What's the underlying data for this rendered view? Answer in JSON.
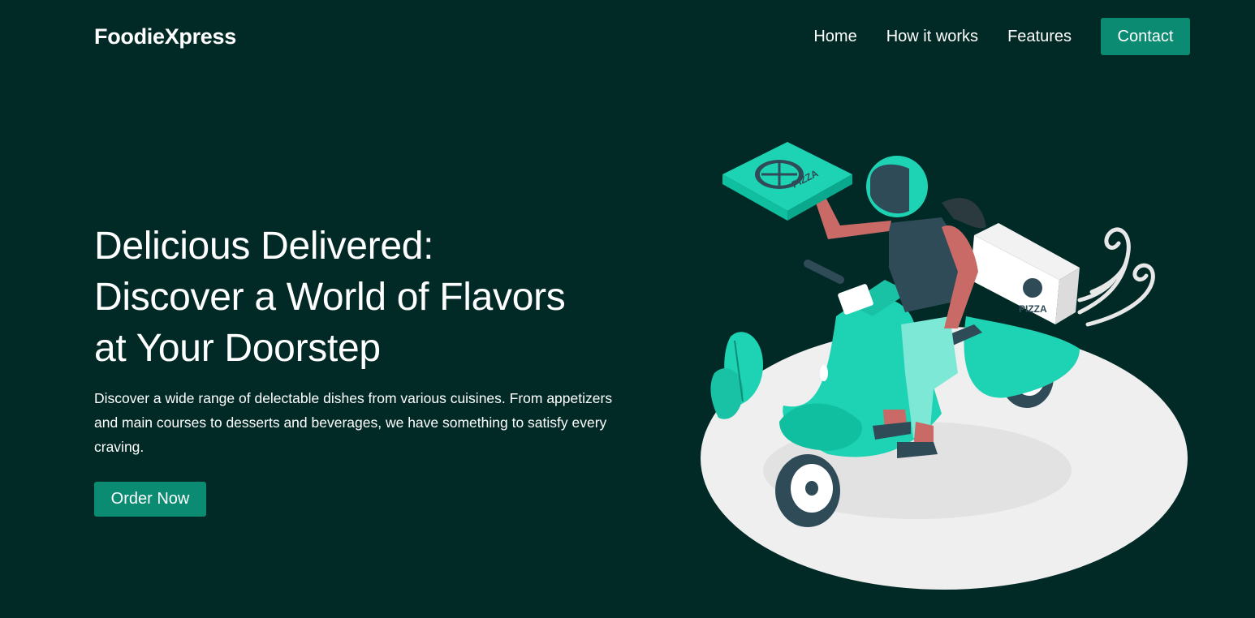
{
  "navbar": {
    "brand": "FoodieXpress",
    "links": [
      "Home",
      "How it works",
      "Features"
    ],
    "contact_label": "Contact"
  },
  "hero": {
    "title_lines": [
      "Delicious Delivered:",
      "Discover a World of Flavors",
      "at Your Doorstep"
    ],
    "description": "Discover a wide range of delectable dishes from various cuisines. From appetizers and main courses to desserts and beverages, we have something to satisfy every craving.",
    "cta_label": "Order Now"
  },
  "illustration": {
    "box_label": "PIZZA",
    "subject": "delivery-scooter-illustration"
  },
  "colors": {
    "background": "#012a26",
    "accent": "#0a8b72",
    "illustration_teal": "#1ed3b4",
    "skin": "#c96a67",
    "platform": "#efefef"
  }
}
